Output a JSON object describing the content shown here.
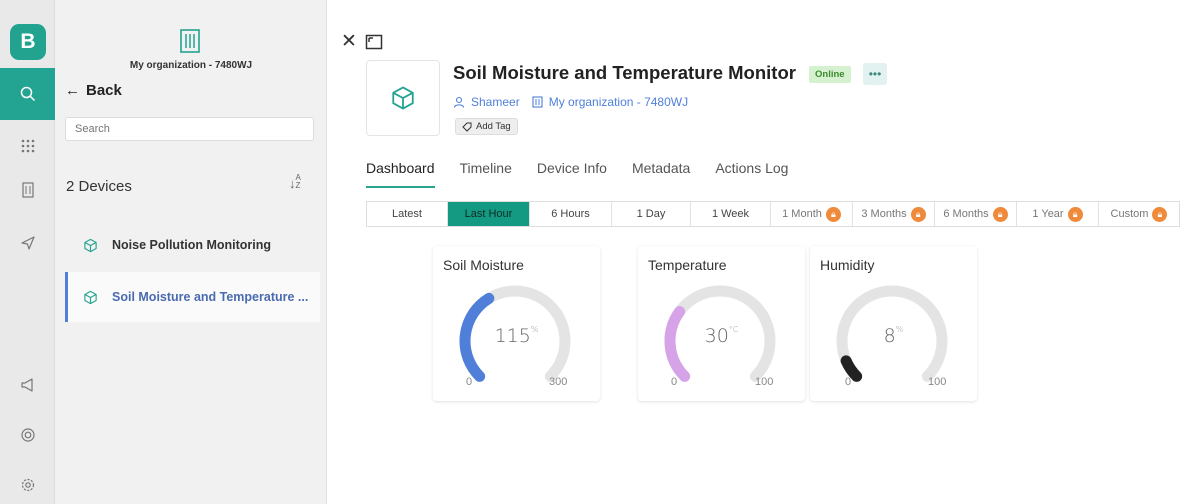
{
  "rail": {
    "logo": "B"
  },
  "sidebar": {
    "org_name": "My organization - 7480WJ",
    "back_label": "Back",
    "search_placeholder": "Search",
    "device_count": "2 Devices",
    "devices": [
      {
        "label": "Noise Pollution Monitoring"
      },
      {
        "label": "Soil Moisture and Temperature ..."
      }
    ]
  },
  "device": {
    "title": "Soil Moisture and Temperature Monitor",
    "status": "Online",
    "owner": "Shameer",
    "org": "My organization - 7480WJ",
    "add_tag": "Add Tag"
  },
  "tabs": [
    "Dashboard",
    "Timeline",
    "Device Info",
    "Metadata",
    "Actions Log"
  ],
  "ranges": [
    "Latest",
    "Last Hour",
    "6 Hours",
    "1 Day",
    "1 Week",
    "1 Month",
    "3 Months",
    "6 Months",
    "1 Year",
    "Custom"
  ],
  "colors": {
    "accent": "#149982",
    "lock": "#ef8a3a",
    "link": "#4f7fd9"
  },
  "gauges": [
    {
      "title": "Soil Moisture",
      "value": "115",
      "unit": "%",
      "min": "0",
      "max": "300",
      "fraction": 0.383,
      "color": "#4f7fd9"
    },
    {
      "title": "Temperature",
      "value": "30",
      "unit": "°C",
      "min": "0",
      "max": "100",
      "fraction": 0.3,
      "color": "#d6a3e8"
    },
    {
      "title": "Humidity",
      "value": "8",
      "unit": "%",
      "min": "0",
      "max": "100",
      "fraction": 0.08,
      "color": "#222222"
    }
  ]
}
